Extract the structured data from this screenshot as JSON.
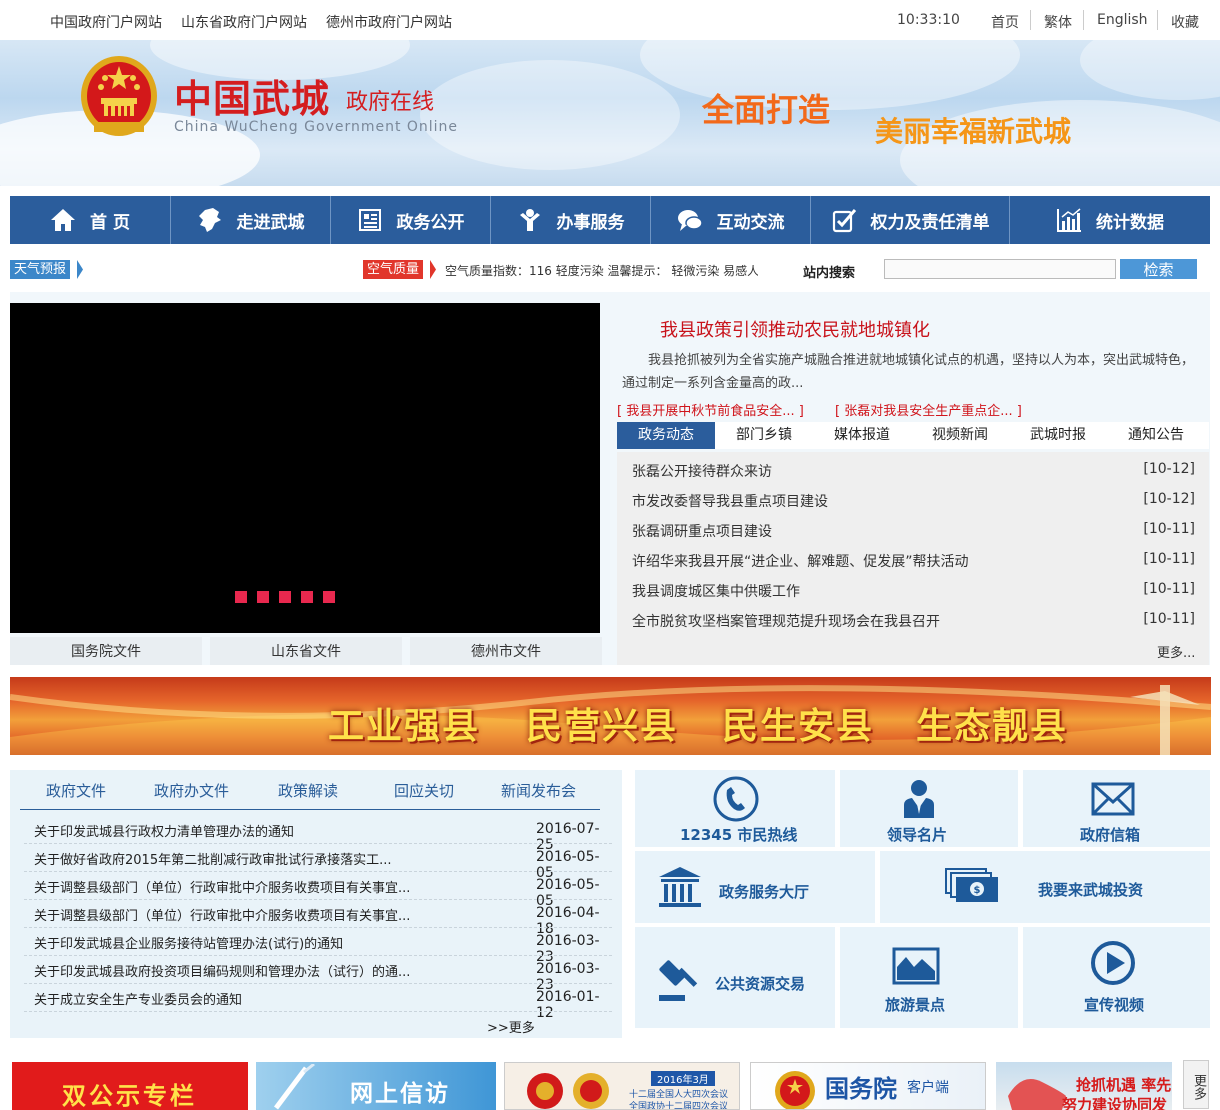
{
  "topbar": {
    "links": [
      "中国政府门户网站",
      "山东省政府门户网站",
      "德州市政府门户网站"
    ],
    "time": "10:33:10",
    "right_links": [
      "首页",
      "繁体",
      "English",
      "收藏"
    ]
  },
  "header": {
    "title": "中国武城",
    "subtitle": "政府在线",
    "english": "China WuCheng Government Online",
    "slogan_left": "全面打造",
    "slogan_right": "美丽幸福新武城"
  },
  "nav": {
    "items": [
      {
        "label": "首 页",
        "icon": "home-icon"
      },
      {
        "label": "走进武城",
        "icon": "map-icon"
      },
      {
        "label": "政务公开",
        "icon": "document-icon"
      },
      {
        "label": "办事服务",
        "icon": "person-service-icon"
      },
      {
        "label": "互动交流",
        "icon": "chat-icon"
      },
      {
        "label": "权力及责任清单",
        "icon": "checklist-icon"
      },
      {
        "label": "统计数据",
        "icon": "chart-icon"
      }
    ]
  },
  "infobar": {
    "weather": "天气预报",
    "air_label": "空气质量",
    "air_text": "空气质量指数：116 轻度污染  温馨提示： 轻微污染 易感人",
    "search_label": "站内搜索",
    "search_value": "",
    "search_button": "检索"
  },
  "doc_tabs": [
    "国务院文件",
    "山东省文件",
    "德州市文件"
  ],
  "feature": {
    "headline": "我县政策引领推动农民就地城镇化",
    "summary": "我县抢抓被列为全省实施产城融合推进就地城镇化试点的机遇，坚持以人为本，突出武城特色，通过制定一系列含金量高的政...",
    "related": [
      "[ 我县开展中秋节前食品安全... ]",
      "[ 张磊对我县安全生产重点企... ]"
    ]
  },
  "news": {
    "tabs": [
      "政务动态",
      "部门乡镇",
      "媒体报道",
      "视频新闻",
      "武城时报",
      "通知公告"
    ],
    "active_tab": 0,
    "items": [
      {
        "title": "张磊公开接待群众来访",
        "date": "[10-12]"
      },
      {
        "title": "市发改委督导我县重点项目建设",
        "date": "[10-12]"
      },
      {
        "title": "张磊调研重点项目建设",
        "date": "[10-11]"
      },
      {
        "title": "许绍华来我县开展“进企业、解难题、促发展”帮扶活动",
        "date": "[10-11]"
      },
      {
        "title": "我县调度城区集中供暖工作",
        "date": "[10-11]"
      },
      {
        "title": "全市脱贫攻坚档案管理规范提升现场会在我县召开",
        "date": "[10-11]"
      }
    ],
    "more": "更多..."
  },
  "banner": {
    "slogans": [
      "工业强县",
      "民营兴县",
      "民生安县",
      "生态靓县"
    ]
  },
  "docs": {
    "tabs": [
      "政府文件",
      "政府办文件",
      "政策解读",
      "回应关切",
      "新闻发布会"
    ],
    "items": [
      {
        "title": "关于印发武城县行政权力清单管理办法的通知",
        "date": "2016-07-25"
      },
      {
        "title": "关于做好省政府2015年第二批削减行政审批试行承接落实工...",
        "date": "2016-05-05"
      },
      {
        "title": "关于调整县级部门（单位）行政审批中介服务收费项目有关事宜...",
        "date": "2016-05-05"
      },
      {
        "title": "关于调整县级部门（单位）行政审批中介服务收费项目有关事宜...",
        "date": "2016-04-18"
      },
      {
        "title": "关于印发武城县企业服务接待站管理办法(试行)的通知",
        "date": "2016-03-23"
      },
      {
        "title": "关于印发武城县政府投资项目编码规则和管理办法（试行）的通...",
        "date": "2016-03-23"
      },
      {
        "title": "关于成立安全生产专业委员会的通知",
        "date": "2016-01-12"
      }
    ],
    "more": ">>更多"
  },
  "services": [
    {
      "label": "12345 市民热线",
      "icon": "phone-icon"
    },
    {
      "label": "领导名片",
      "icon": "leader-icon"
    },
    {
      "label": "政府信箱",
      "icon": "mail-icon"
    },
    {
      "label": "政务服务大厅",
      "icon": "building-icon"
    },
    {
      "label": "我要来武城投资",
      "icon": "money-icon"
    },
    {
      "label": "公共资源交易",
      "icon": "gavel-icon"
    },
    {
      "label": "旅游景点",
      "icon": "picture-icon"
    },
    {
      "label": "宣传视频",
      "icon": "play-icon"
    }
  ],
  "bottom_banners": {
    "b1": "双公示专栏",
    "b2": "网上信访",
    "b3_caption": "2016年3月",
    "b3_text1": "十二届全国人大四次会议",
    "b3_text2": "全国政协十二届四次会议",
    "b4_title": "国务院",
    "b4_sub": "客户端",
    "b5_text": "抢抓机遇  率先",
    "b5_text2": "努力建设协同发",
    "more": "更多"
  },
  "colors": {
    "nav_bg": "#2b5d9c",
    "accent_red": "#c8131b",
    "active_tab": "#2b5d9c",
    "slogan_orange": "#f56a10"
  }
}
